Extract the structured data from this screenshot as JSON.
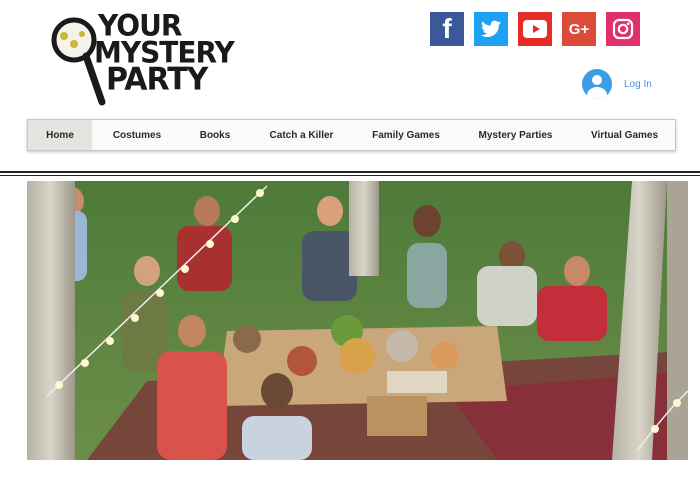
{
  "brand": {
    "logo_lines": [
      "YOUR",
      "MYSTERY",
      "PARTY"
    ]
  },
  "social": [
    {
      "name": "facebook",
      "glyph": "f"
    },
    {
      "name": "twitter",
      "glyph": ""
    },
    {
      "name": "youtube",
      "glyph": ""
    },
    {
      "name": "google-plus",
      "glyph": "G+"
    },
    {
      "name": "instagram",
      "glyph": ""
    }
  ],
  "login": {
    "label": "Log In"
  },
  "nav": {
    "items": [
      {
        "label": "Home",
        "active": true
      },
      {
        "label": "Costumes"
      },
      {
        "label": "Books"
      },
      {
        "label": "Catch a Killer"
      },
      {
        "label": "Family Games"
      },
      {
        "label": "Mystery Parties"
      },
      {
        "label": "Virtual Games"
      }
    ]
  },
  "colors": {
    "facebook": "#3b5998",
    "twitter": "#1da1f2",
    "youtube": "#e52d27",
    "google_plus": "#dd4b39",
    "instagram": "#e1306c",
    "link_blue": "#4a90d9",
    "nav_active_bg": "#e6e4e0"
  }
}
